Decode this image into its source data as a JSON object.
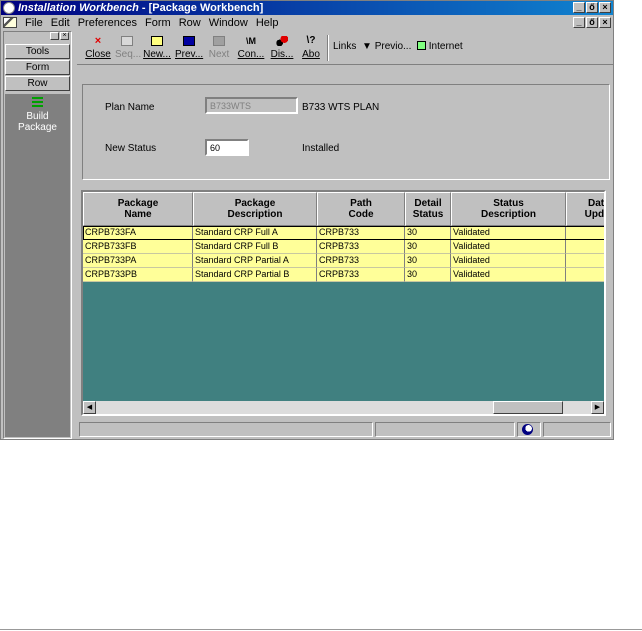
{
  "window": {
    "title_app": "Installation Workbench",
    "title_rest": " - [Package Workbench]",
    "min_label": "_",
    "max_label": "ő",
    "close_label": "×"
  },
  "menu": {
    "items": [
      "File",
      "Edit",
      "Preferences",
      "Form",
      "Row",
      "Window",
      "Help"
    ]
  },
  "left_panel": {
    "tabs": [
      "Tools",
      "Form",
      "Row"
    ],
    "exit_item": "Build\nPackage"
  },
  "toolbar": {
    "buttons": [
      "Close",
      "Seq...",
      "New...",
      "Prev...",
      "Next",
      "Con...",
      "Dis...",
      "Abo"
    ],
    "links_label": "Links",
    "previo_label": "Previo...",
    "internet_label": "Internet"
  },
  "form": {
    "plan_name_label": "Plan Name",
    "plan_name_value": "B733WTS",
    "plan_name_desc": "B733 WTS PLAN",
    "new_status_label": "New Status",
    "new_status_value": "60",
    "new_status_desc": "Installed"
  },
  "grid": {
    "headers": [
      "Package\nName",
      "Package\nDescription",
      "Path\nCode",
      "Detail\nStatus",
      "Status\nDescription",
      "Date\nUpdat"
    ],
    "rows": [
      [
        "CRPB733FA",
        "Standard CRP Full  A",
        "CRPB733",
        "30",
        "Validated",
        ""
      ],
      [
        "CRPB733FB",
        "Standard CRP Full  B",
        "CRPB733",
        "30",
        "Validated",
        ""
      ],
      [
        "CRPB733PA",
        "Standard CRP Partial  A",
        "CRPB733",
        "30",
        "Validated",
        ""
      ],
      [
        "CRPB733PB",
        "Standard CRP Partial  B",
        "CRPB733",
        "30",
        "Validated",
        ""
      ]
    ],
    "selected_row": 0
  },
  "colors": {
    "title_gradient_start": "#000080",
    "grid_background": "#408080",
    "row_highlight": "#ffff99"
  }
}
